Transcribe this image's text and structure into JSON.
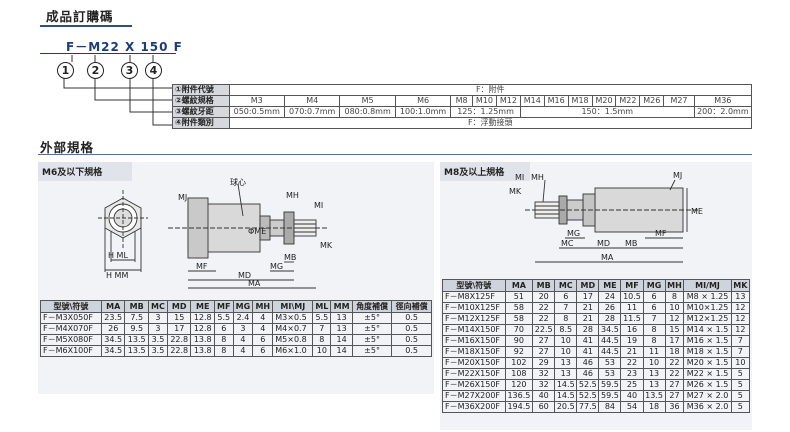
{
  "title": "成品訂購碼",
  "model_code": "F－M22 X 150  F",
  "code_circles": [
    "1",
    "2",
    "3",
    "4"
  ],
  "code_table": {
    "rows": [
      {
        "num": "①",
        "label": "附件代號",
        "cells": [
          "F：附件"
        ]
      },
      {
        "num": "②",
        "label": "螺紋規格",
        "cells": [
          "M3",
          "M4",
          "M5",
          "M6",
          "M8",
          "M10",
          "M12",
          "M14",
          "M16",
          "M18",
          "M20",
          "M22",
          "M26",
          "M27",
          "M36"
        ]
      },
      {
        "num": "③",
        "label": "螺紋牙距",
        "cells": [
          "050:0.5mm",
          "070:0.7mm",
          "080:0.8mm",
          "100:1.0mm",
          "125：1.25mm",
          "150：1.5mm",
          "200：2.0mm"
        ]
      },
      {
        "num": "④",
        "label": "附件類別",
        "cells": [
          "F：浮動接頭"
        ]
      }
    ]
  },
  "external_title": "外部規格",
  "left_section": {
    "title": "M6及以下規格",
    "drawing_labels": {
      "ball": "球心",
      "mj": "MJ",
      "mh": "MH",
      "mi": "MI",
      "mk": "MK",
      "me": "ΦME",
      "ml": "ML",
      "hml": "H  ML",
      "hmm": "H  MM",
      "mf": "MF",
      "mg": "MG",
      "mb": "MB",
      "md": "MD",
      "ma": "MA"
    },
    "headers": [
      "型號\\符號",
      "MA",
      "MB",
      "MC",
      "MD",
      "ME",
      "MF",
      "MG",
      "MH",
      "MI\\MJ",
      "ML",
      "MM",
      "角度補償",
      "徑向補償"
    ],
    "rows": [
      [
        "F－M3X050F",
        "23.5",
        "7.5",
        "3",
        "15",
        "12.8",
        "5.5",
        "2.4",
        "4",
        "M3×0.5",
        "5.5",
        "13",
        "±5°",
        "0.5"
      ],
      [
        "F－M4X070F",
        "26",
        "9.5",
        "3",
        "17",
        "12.8",
        "6",
        "3",
        "4",
        "M4×0.7",
        "7",
        "13",
        "±5°",
        "0.5"
      ],
      [
        "F－M5X080F",
        "34.5",
        "13.5",
        "3.5",
        "22.8",
        "13.8",
        "8",
        "4",
        "6",
        "M5×0.8",
        "8",
        "14",
        "±5°",
        "0.5"
      ],
      [
        "F－M6X100F",
        "34.5",
        "13.5",
        "3.5",
        "22.8",
        "13.8",
        "8",
        "4",
        "6",
        "M6×1.0",
        "10",
        "14",
        "±5°",
        "0.5"
      ]
    ]
  },
  "right_section": {
    "title": "M8及以上規格",
    "drawing_labels": {
      "mi": "MI",
      "mh": "MH",
      "mj": "MJ",
      "mk": "MK",
      "me": "ME",
      "mg": "MG",
      "mc": "MC",
      "md": "MD",
      "mf": "MF",
      "mb": "MB",
      "ma": "MA"
    },
    "headers": [
      "型號\\符號",
      "MA",
      "MB",
      "MC",
      "MD",
      "ME",
      "MF",
      "MG",
      "MH",
      "MI/MJ",
      "MK"
    ],
    "rows": [
      [
        "F－M8X125F",
        "51",
        "20",
        "6",
        "17",
        "24",
        "10.5",
        "6",
        "8",
        "M8 × 1.25",
        "13"
      ],
      [
        "F－M10X125F",
        "58",
        "22",
        "7",
        "21",
        "26",
        "11",
        "6",
        "10",
        "M10×1.25",
        "12"
      ],
      [
        "F－M12X125F",
        "58",
        "22",
        "8",
        "21",
        "28",
        "11.5",
        "7",
        "12",
        "M12×1.25",
        "12"
      ],
      [
        "F－M14X150F",
        "70",
        "22.5",
        "8.5",
        "28",
        "34.5",
        "16",
        "8",
        "15",
        "M14 × 1.5",
        "12"
      ],
      [
        "F－M16X150F",
        "90",
        "27",
        "10",
        "41",
        "44.5",
        "19",
        "8",
        "17",
        "M16 × 1.5",
        "7"
      ],
      [
        "F－M18X150F",
        "92",
        "27",
        "10",
        "41",
        "44.5",
        "21",
        "11",
        "18",
        "M18 × 1.5",
        "7"
      ],
      [
        "F－M20X150F",
        "102",
        "29",
        "13",
        "46",
        "53",
        "22",
        "10",
        "22",
        "M20 × 1.5",
        "10"
      ],
      [
        "F－M22X150F",
        "108",
        "32",
        "13",
        "46",
        "53",
        "23",
        "13",
        "22",
        "M22 × 1.5",
        "5"
      ],
      [
        "F－M26X150F",
        "120",
        "32",
        "14.5",
        "52.5",
        "59.5",
        "25",
        "13",
        "27",
        "M26 × 1.5",
        "5"
      ],
      [
        "F－M27X200F",
        "136.5",
        "40",
        "14.5",
        "52.5",
        "59.5",
        "40",
        "13.5",
        "27",
        "M27 × 2.0",
        "5"
      ],
      [
        "F－M36X200F",
        "194.5",
        "60",
        "20.5",
        "77.5",
        "84",
        "54",
        "18",
        "36",
        "M36 × 2.0",
        "5"
      ]
    ]
  }
}
